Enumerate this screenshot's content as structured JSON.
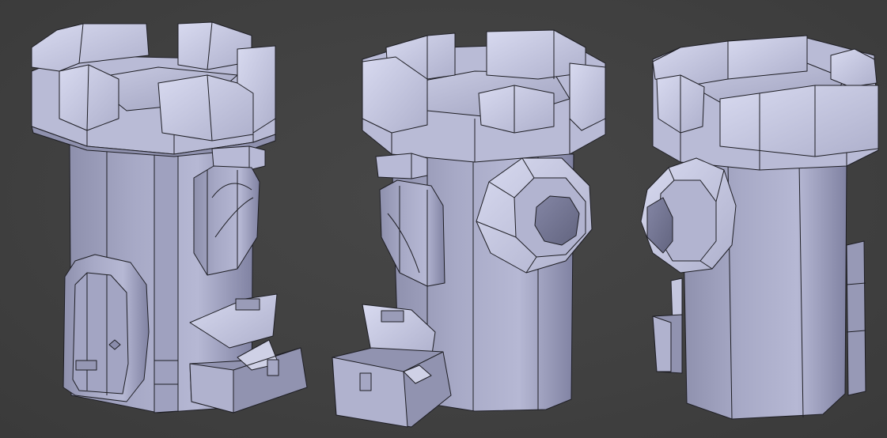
{
  "scene": {
    "background_color": "#3f3f3f",
    "mesh_light_color": "#d4d6ee",
    "mesh_mid_color": "#a6a8c6",
    "mesh_dark_color": "#6d6f8e",
    "wire_color": "#1e1e24",
    "views": [
      {
        "name": "front-view",
        "parts": [
          "tower-body",
          "crenellated-top",
          "door",
          "lantern",
          "chest"
        ]
      },
      {
        "name": "side-view",
        "parts": [
          "tower-body",
          "crenellated-top",
          "round-window",
          "lantern",
          "chest"
        ]
      },
      {
        "name": "back-view",
        "parts": [
          "tower-body",
          "crenellated-top",
          "round-window",
          "chest"
        ]
      }
    ]
  }
}
